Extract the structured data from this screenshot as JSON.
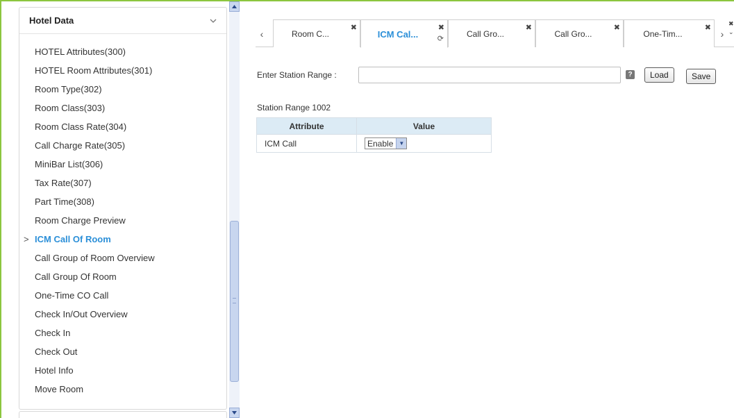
{
  "sidebar": {
    "title": "Hotel Data",
    "items": [
      {
        "label": "HOTEL Attributes(300)"
      },
      {
        "label": "HOTEL Room Attributes(301)"
      },
      {
        "label": "Room Type(302)"
      },
      {
        "label": "Room Class(303)"
      },
      {
        "label": "Room Class Rate(304)"
      },
      {
        "label": "Call Charge Rate(305)"
      },
      {
        "label": "MiniBar List(306)"
      },
      {
        "label": "Tax Rate(307)"
      },
      {
        "label": "Part Time(308)"
      },
      {
        "label": "Room Charge Preview"
      },
      {
        "label": "ICM Call Of Room",
        "active": true
      },
      {
        "label": "Call Group of Room Overview"
      },
      {
        "label": "Call Group Of Room"
      },
      {
        "label": "One-Time CO Call"
      },
      {
        "label": "Check In/Out Overview"
      },
      {
        "label": "Check In"
      },
      {
        "label": "Check Out"
      },
      {
        "label": "Hotel Info"
      },
      {
        "label": "Move Room"
      }
    ]
  },
  "tabs": [
    {
      "label": "Room C..."
    },
    {
      "label": "ICM Cal...",
      "active": true
    },
    {
      "label": "Call Gro..."
    },
    {
      "label": "Call Gro..."
    },
    {
      "label": "One-Tim..."
    }
  ],
  "form": {
    "range_label": "Enter Station Range :",
    "range_value": "",
    "load_label": "Load",
    "save_label": "Save"
  },
  "section": {
    "title": "Station Range 1002"
  },
  "table": {
    "headers": [
      "Attribute",
      "Value"
    ],
    "rows": [
      {
        "attribute": "ICM Call",
        "value": "Enable"
      }
    ]
  },
  "colors": {
    "accent": "#2b8fd8",
    "frame": "#8cc63f",
    "table_header": "#dcebf5"
  }
}
